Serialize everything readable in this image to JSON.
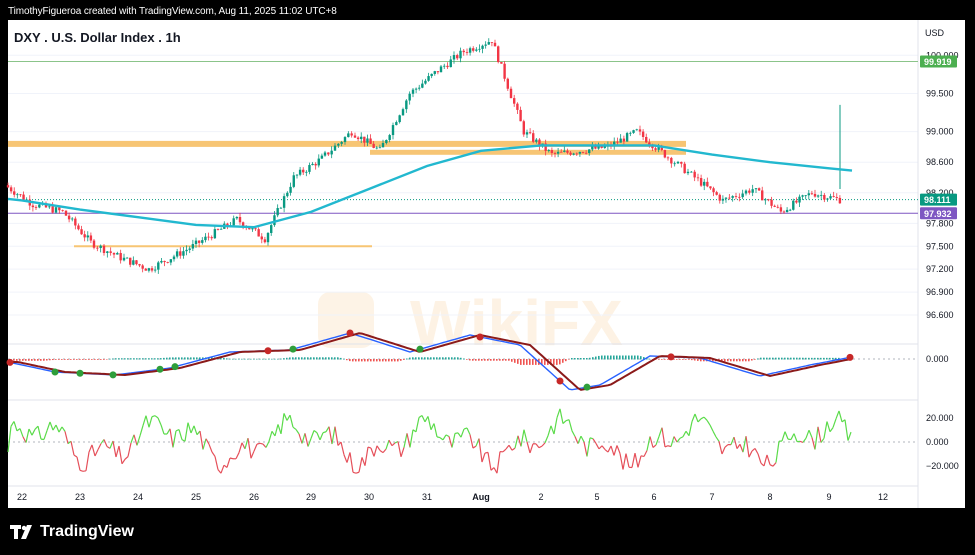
{
  "header": {
    "credit": "TimothyFigueroa created with TradingView.com, Aug 11, 2025 11:02 UTC+8",
    "title": "DXY . U.S. Dollar Index . 1h",
    "currency": "USD"
  },
  "footer": {
    "brand": "TradingView"
  },
  "watermark": "WikiFX",
  "chart_data": {
    "type": "candlestick",
    "symbol": "DXY",
    "name": "U.S. Dollar Index",
    "interval": "1h",
    "ylim": [
      96.6,
      100.2
    ],
    "y_ticks": [
      "100.000",
      "99.500",
      "99.000",
      "98.600",
      "98.200",
      "97.800",
      "97.500",
      "97.200",
      "96.900",
      "96.600"
    ],
    "x_ticks": [
      "22",
      "23",
      "24",
      "25",
      "26",
      "29",
      "30",
      "31",
      "Aug",
      "2",
      "5",
      "6",
      "7",
      "8",
      "9",
      "12"
    ],
    "price_path": [
      [
        "22",
        98.3
      ],
      [
        "22",
        98.05
      ],
      [
        "23",
        97.95
      ],
      [
        "23",
        97.55
      ],
      [
        "24",
        97.35
      ],
      [
        "24",
        97.2
      ],
      [
        "25",
        97.5
      ],
      [
        "26",
        97.85
      ],
      [
        "26",
        97.6
      ],
      [
        "29",
        98.4
      ],
      [
        "29",
        98.65
      ],
      [
        "30",
        99.0
      ],
      [
        "30",
        98.75
      ],
      [
        "31",
        99.5
      ],
      [
        "31",
        99.8
      ],
      [
        "Aug",
        100.05
      ],
      [
        "Aug",
        100.2
      ],
      [
        "2",
        99.0
      ],
      [
        "2",
        98.7
      ],
      [
        "5",
        98.75
      ],
      [
        "5",
        98.8
      ],
      [
        "6",
        99.0
      ],
      [
        "6",
        98.7
      ],
      [
        "7",
        98.4
      ],
      [
        "7",
        98.1
      ],
      [
        "8",
        98.25
      ],
      [
        "8",
        97.95
      ],
      [
        "9",
        98.2
      ],
      [
        "9",
        98.11
      ]
    ],
    "moving_average": [
      [
        "22",
        98.1
      ],
      [
        "23",
        97.98
      ],
      [
        "24",
        97.88
      ],
      [
        "25",
        97.78
      ],
      [
        "26",
        97.75
      ],
      [
        "29",
        97.95
      ],
      [
        "30",
        98.25
      ],
      [
        "31",
        98.55
      ],
      [
        "Aug",
        98.75
      ],
      [
        "2",
        98.82
      ],
      [
        "5",
        98.82
      ],
      [
        "6",
        98.82
      ],
      [
        "7",
        98.7
      ],
      [
        "8",
        98.6
      ],
      [
        "9",
        98.52
      ]
    ],
    "levels": {
      "last_price": {
        "label": "98.111",
        "value": 98.111
      },
      "resistance_green": {
        "label": "99.919",
        "value": 99.919
      },
      "purple": {
        "label": "97.932",
        "value": 97.932
      }
    },
    "zones": [
      {
        "name": "upper-zone",
        "value": 98.84
      },
      {
        "name": "mid-zone",
        "value": 98.73
      },
      {
        "name": "low-zone",
        "value": 97.5
      }
    ],
    "macd": {
      "y_ticks": [
        "0.000"
      ],
      "dots_red": 7,
      "dots_green": 8
    },
    "oscillator": {
      "y_ticks": [
        "20.000",
        "0.000",
        "−20.000"
      ]
    },
    "colors": {
      "up": "#089981",
      "down": "#f23645",
      "ma": "#22b8cf",
      "zone": "#f7c574",
      "green_line": "#8bc48a",
      "purple_line": "#7e57c2",
      "osc_up": "#5bdb4a",
      "osc_down": "#e5505a"
    }
  }
}
